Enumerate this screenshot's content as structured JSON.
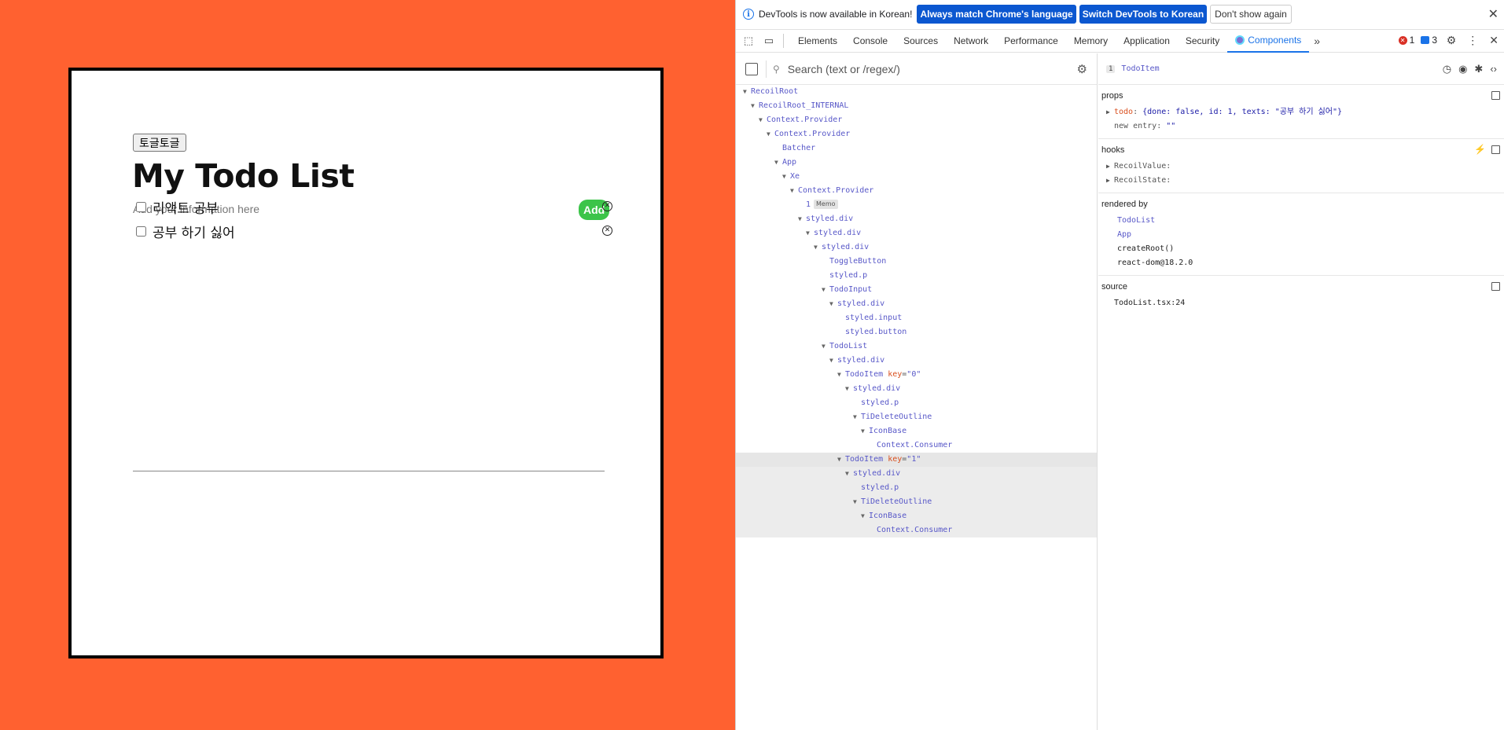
{
  "app": {
    "toggle_label": "토글토글",
    "title": "My Todo List",
    "input_placeholder": "Add your information here",
    "add_label": "Add",
    "todos": [
      {
        "text": "리액트 공부",
        "done": false
      },
      {
        "text": "공부 하기 싫어",
        "done": false
      }
    ]
  },
  "devtools": {
    "infobar": {
      "message": "DevTools is now available in Korean!",
      "btn_match": "Always match Chrome's language",
      "btn_switch": "Switch DevTools to Korean",
      "btn_dismiss": "Don't show again"
    },
    "tabs": [
      "Elements",
      "Console",
      "Sources",
      "Network",
      "Performance",
      "Memory",
      "Application",
      "Security",
      "Components"
    ],
    "active_tab": "Components",
    "error_count": "1",
    "message_count": "3",
    "search_placeholder": "Search (text or /regex/)",
    "tree": [
      {
        "name": "RecoilRoot",
        "depth": 0,
        "arrow": true
      },
      {
        "name": "RecoilRoot_INTERNAL",
        "depth": 1,
        "arrow": true
      },
      {
        "name": "Context.Provider",
        "depth": 2,
        "arrow": true
      },
      {
        "name": "Context.Provider",
        "depth": 3,
        "arrow": true
      },
      {
        "name": "Batcher",
        "depth": 4,
        "arrow": false
      },
      {
        "name": "App",
        "depth": 4,
        "arrow": true
      },
      {
        "name": "Xe",
        "depth": 5,
        "arrow": true
      },
      {
        "name": "Context.Provider",
        "depth": 6,
        "arrow": true
      },
      {
        "name": "1",
        "depth": 7,
        "arrow": false,
        "badge": "Memo"
      },
      {
        "name": "styled.div",
        "depth": 7,
        "arrow": true
      },
      {
        "name": "styled.div",
        "depth": 8,
        "arrow": true
      },
      {
        "name": "styled.div",
        "depth": 9,
        "arrow": true
      },
      {
        "name": "ToggleButton",
        "depth": 10,
        "arrow": false
      },
      {
        "name": "styled.p",
        "depth": 10,
        "arrow": false
      },
      {
        "name": "TodoInput",
        "depth": 10,
        "arrow": true
      },
      {
        "name": "styled.div",
        "depth": 11,
        "arrow": true
      },
      {
        "name": "styled.input",
        "depth": 12,
        "arrow": false
      },
      {
        "name": "styled.button",
        "depth": 12,
        "arrow": false
      },
      {
        "name": "TodoList",
        "depth": 10,
        "arrow": true
      },
      {
        "name": "styled.div",
        "depth": 11,
        "arrow": true
      },
      {
        "name": "TodoItem",
        "depth": 12,
        "arrow": true,
        "key": "0"
      },
      {
        "name": "styled.div",
        "depth": 13,
        "arrow": true
      },
      {
        "name": "styled.p",
        "depth": 14,
        "arrow": false
      },
      {
        "name": "TiDeleteOutline",
        "depth": 14,
        "arrow": true
      },
      {
        "name": "IconBase",
        "depth": 15,
        "arrow": true
      },
      {
        "name": "Context.Consumer",
        "depth": 16,
        "arrow": false
      },
      {
        "name": "TodoItem",
        "depth": 12,
        "arrow": true,
        "key": "1",
        "state": "selected"
      },
      {
        "name": "styled.div",
        "depth": 13,
        "arrow": true,
        "state": "group"
      },
      {
        "name": "styled.p",
        "depth": 14,
        "arrow": false,
        "state": "group"
      },
      {
        "name": "TiDeleteOutline",
        "depth": 14,
        "arrow": true,
        "state": "group"
      },
      {
        "name": "IconBase",
        "depth": 15,
        "arrow": true,
        "state": "group"
      },
      {
        "name": "Context.Consumer",
        "depth": 16,
        "arrow": false,
        "state": "group"
      }
    ],
    "inspector": {
      "index": "1",
      "component": "TodoItem",
      "props_title": "props",
      "prop_todo_key": "todo",
      "prop_todo_value": "{done: false, id: 1, texts: \"공부 하기 싫어\"}",
      "prop_new_entry_key": "new entry",
      "prop_new_entry_value": "\"\"",
      "hooks_title": "hooks",
      "hook_1": "RecoilValue:",
      "hook_2": "RecoilState:",
      "rendered_by_title": "rendered by",
      "rendered_by": [
        {
          "name": "TodoList",
          "component": true
        },
        {
          "name": "App",
          "component": true
        },
        {
          "name": "createRoot()",
          "component": false
        },
        {
          "name": "react-dom@18.2.0",
          "component": false
        }
      ],
      "source_title": "source",
      "source_file": "TodoList.tsx:24"
    }
  }
}
